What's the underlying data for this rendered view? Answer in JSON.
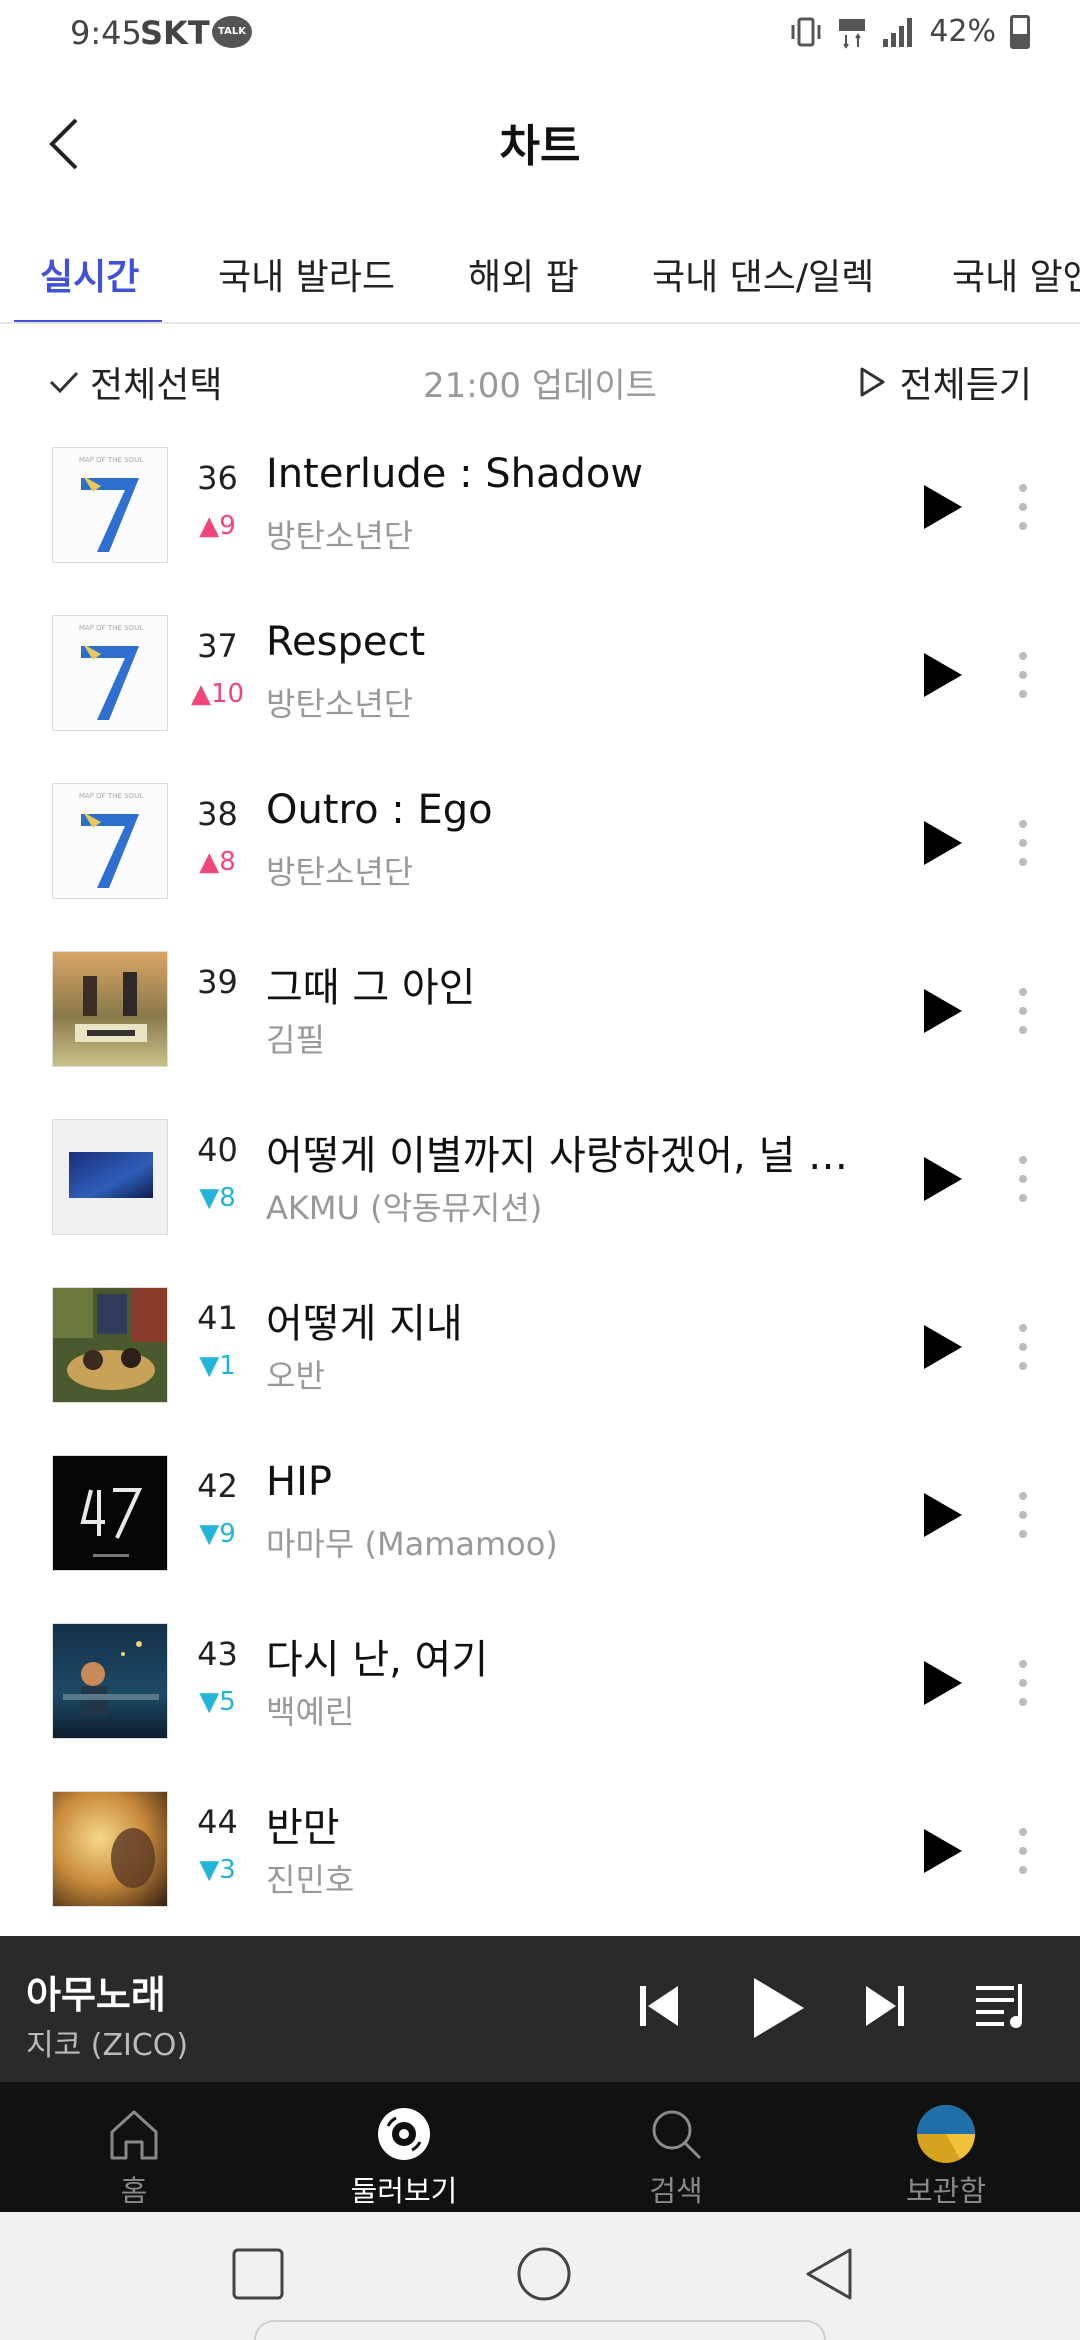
{
  "status_bar": {
    "time": "9:45",
    "carrier": "SKT",
    "talk_badge": "TALK",
    "battery": "42%"
  },
  "header": {
    "title": "차트"
  },
  "tabs": [
    {
      "label": "실시간",
      "active": true
    },
    {
      "label": "국내 발라드",
      "active": false
    },
    {
      "label": "해외 팝",
      "active": false
    },
    {
      "label": "국내 댄스/일렉",
      "active": false
    },
    {
      "label": "국내 알앤",
      "active": false
    }
  ],
  "toolbar": {
    "select_all": "전체선택",
    "update": "21:00 업데이트",
    "play_all": "전체듣기"
  },
  "songs": [
    {
      "rank": "36",
      "change": "▲9",
      "trend": "up",
      "title": "Interlude : Shadow",
      "artist": "방탄소년단",
      "cover": "bts"
    },
    {
      "rank": "37",
      "change": "▲10",
      "trend": "up",
      "title": "Respect",
      "artist": "방탄소년단",
      "cover": "bts"
    },
    {
      "rank": "38",
      "change": "▲8",
      "trend": "up",
      "title": "Outro : Ego",
      "artist": "방탄소년단",
      "cover": "bts"
    },
    {
      "rank": "39",
      "change": "",
      "trend": "same",
      "title": "그때 그 아인",
      "artist": "김필",
      "cover": "kimfeel"
    },
    {
      "rank": "40",
      "change": "▼8",
      "trend": "down",
      "title": "어떻게 이별까지 사랑하겠어, 널 사랑하는 거지",
      "artist": "AKMU (악동뮤지션)",
      "cover": "akmu"
    },
    {
      "rank": "41",
      "change": "▼1",
      "trend": "down",
      "title": "어떻게 지내",
      "artist": "오반",
      "cover": "oban"
    },
    {
      "rank": "42",
      "change": "▼9",
      "trend": "down",
      "title": "HIP",
      "artist": "마마무 (Mamamoo)",
      "cover": "mamamoo"
    },
    {
      "rank": "43",
      "change": "▼5",
      "trend": "down",
      "title": "다시 난, 여기",
      "artist": "백예린",
      "cover": "baek"
    },
    {
      "rank": "44",
      "change": "▼3",
      "trend": "down",
      "title": "반만",
      "artist": "진민호",
      "cover": "jin"
    }
  ],
  "player": {
    "song": "아무노래",
    "artist": "지코 (ZICO)"
  },
  "bottom_nav": [
    {
      "label": "홈",
      "icon": "home-icon",
      "active": false
    },
    {
      "label": "둘러보기",
      "icon": "disc-icon",
      "active": true
    },
    {
      "label": "검색",
      "icon": "search-icon",
      "active": false
    },
    {
      "label": "보관함",
      "icon": "library-avatar-icon",
      "active": false
    }
  ],
  "colors": {
    "accent": "#3f51d9",
    "up": "#f0467a",
    "down": "#22b4d8",
    "player_bg": "#2a2a2a",
    "nav_bg": "#111111"
  }
}
